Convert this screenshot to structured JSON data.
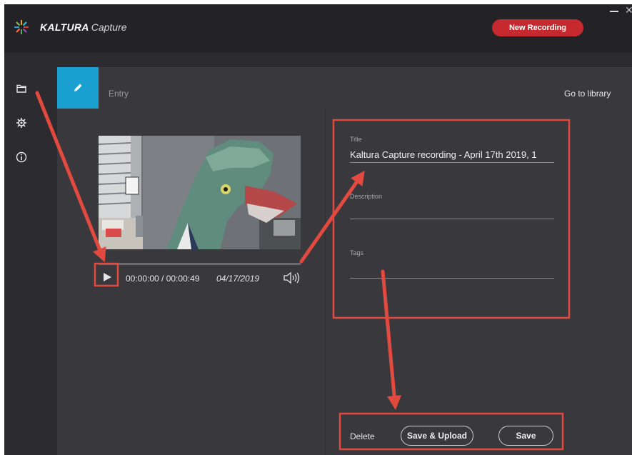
{
  "app": {
    "brand_name": "KALTURA",
    "brand_product": "Capture",
    "new_recording_label": "New Recording",
    "accent_color": "#1a9fd1",
    "record_color": "#c62a2e"
  },
  "sidebar": {
    "items": [
      {
        "icon": "folder-icon"
      },
      {
        "icon": "gear-icon"
      },
      {
        "icon": "info-icon"
      }
    ]
  },
  "entry": {
    "tab_label": "Entry",
    "library_link": "Go to library"
  },
  "player": {
    "time_display": "00:00:00 / 00:00:49",
    "date": "04/17/2019"
  },
  "form": {
    "title_label": "Title",
    "title_value": "Kaltura Capture recording - April 17th 2019, 1",
    "description_label": "Description",
    "description_value": "",
    "tags_label": "Tags",
    "tags_value": ""
  },
  "actions": {
    "delete_label": "Delete",
    "save_upload_label": "Save & Upload",
    "save_label": "Save"
  },
  "annotations": {
    "color": "#e24a3f"
  }
}
